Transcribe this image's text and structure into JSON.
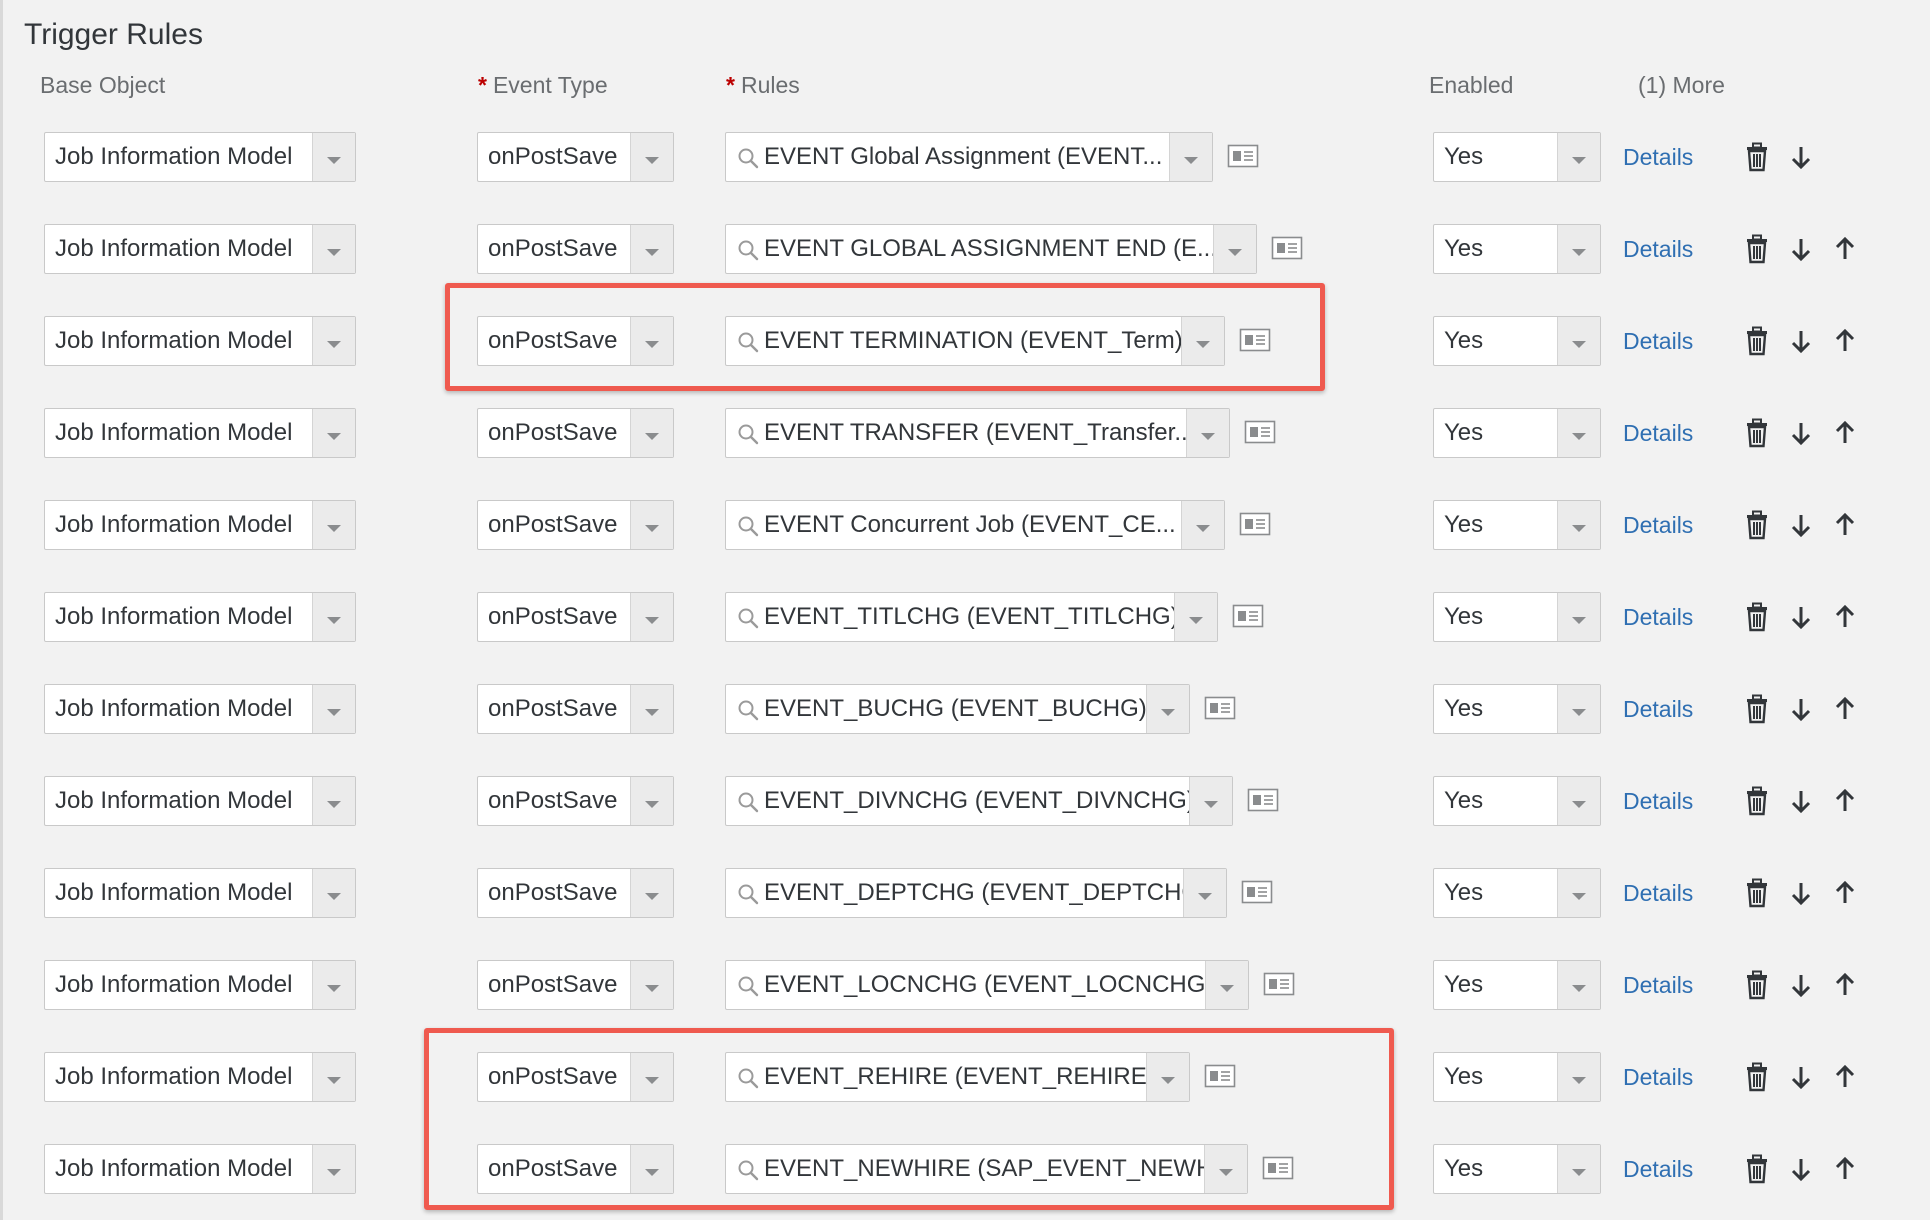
{
  "title": "Trigger Rules",
  "columns": {
    "base_object": "Base Object",
    "event_type": "Event Type",
    "rules": "Rules",
    "enabled": "Enabled",
    "more": "(1) More",
    "required_marker": "*"
  },
  "details_label": "Details",
  "highlight_color": "#ef5a4f",
  "link_color": "#2f6fb2",
  "rows": [
    {
      "base_object": "Job Information Model",
      "event_type": "onPostSave",
      "rule": "EVENT Global Assignment (EVENT...",
      "enabled": "Yes"
    },
    {
      "base_object": "Job Information Model",
      "event_type": "onPostSave",
      "rule": "EVENT GLOBAL ASSIGNMENT END (E...",
      "enabled": "Yes"
    },
    {
      "base_object": "Job Information Model",
      "event_type": "onPostSave",
      "rule": "EVENT TERMINATION (EVENT_Term)",
      "enabled": "Yes"
    },
    {
      "base_object": "Job Information Model",
      "event_type": "onPostSave",
      "rule": "EVENT TRANSFER (EVENT_Transfer...",
      "enabled": "Yes"
    },
    {
      "base_object": "Job Information Model",
      "event_type": "onPostSave",
      "rule": "EVENT Concurrent Job (EVENT_CE...",
      "enabled": "Yes"
    },
    {
      "base_object": "Job Information Model",
      "event_type": "onPostSave",
      "rule": "EVENT_TITLCHG (EVENT_TITLCHG)",
      "enabled": "Yes"
    },
    {
      "base_object": "Job Information Model",
      "event_type": "onPostSave",
      "rule": "EVENT_BUCHG (EVENT_BUCHG)",
      "enabled": "Yes"
    },
    {
      "base_object": "Job Information Model",
      "event_type": "onPostSave",
      "rule": "EVENT_DIVNCHG (EVENT_DIVNCHG)",
      "enabled": "Yes"
    },
    {
      "base_object": "Job Information Model",
      "event_type": "onPostSave",
      "rule": "EVENT_DEPTCHG (EVENT_DEPTCHG)",
      "enabled": "Yes"
    },
    {
      "base_object": "Job Information Model",
      "event_type": "onPostSave",
      "rule": "EVENT_LOCNCHG (EVENT_LOCNCHG)",
      "enabled": "Yes"
    },
    {
      "base_object": "Job Information Model",
      "event_type": "onPostSave",
      "rule": "EVENT_REHIRE (EVENT_REHIRE)",
      "enabled": "Yes"
    },
    {
      "base_object": "Job Information Model",
      "event_type": "onPostSave",
      "rule": "EVENT_NEWHIRE (SAP_EVENT_NEWHI...",
      "enabled": "Yes"
    }
  ]
}
